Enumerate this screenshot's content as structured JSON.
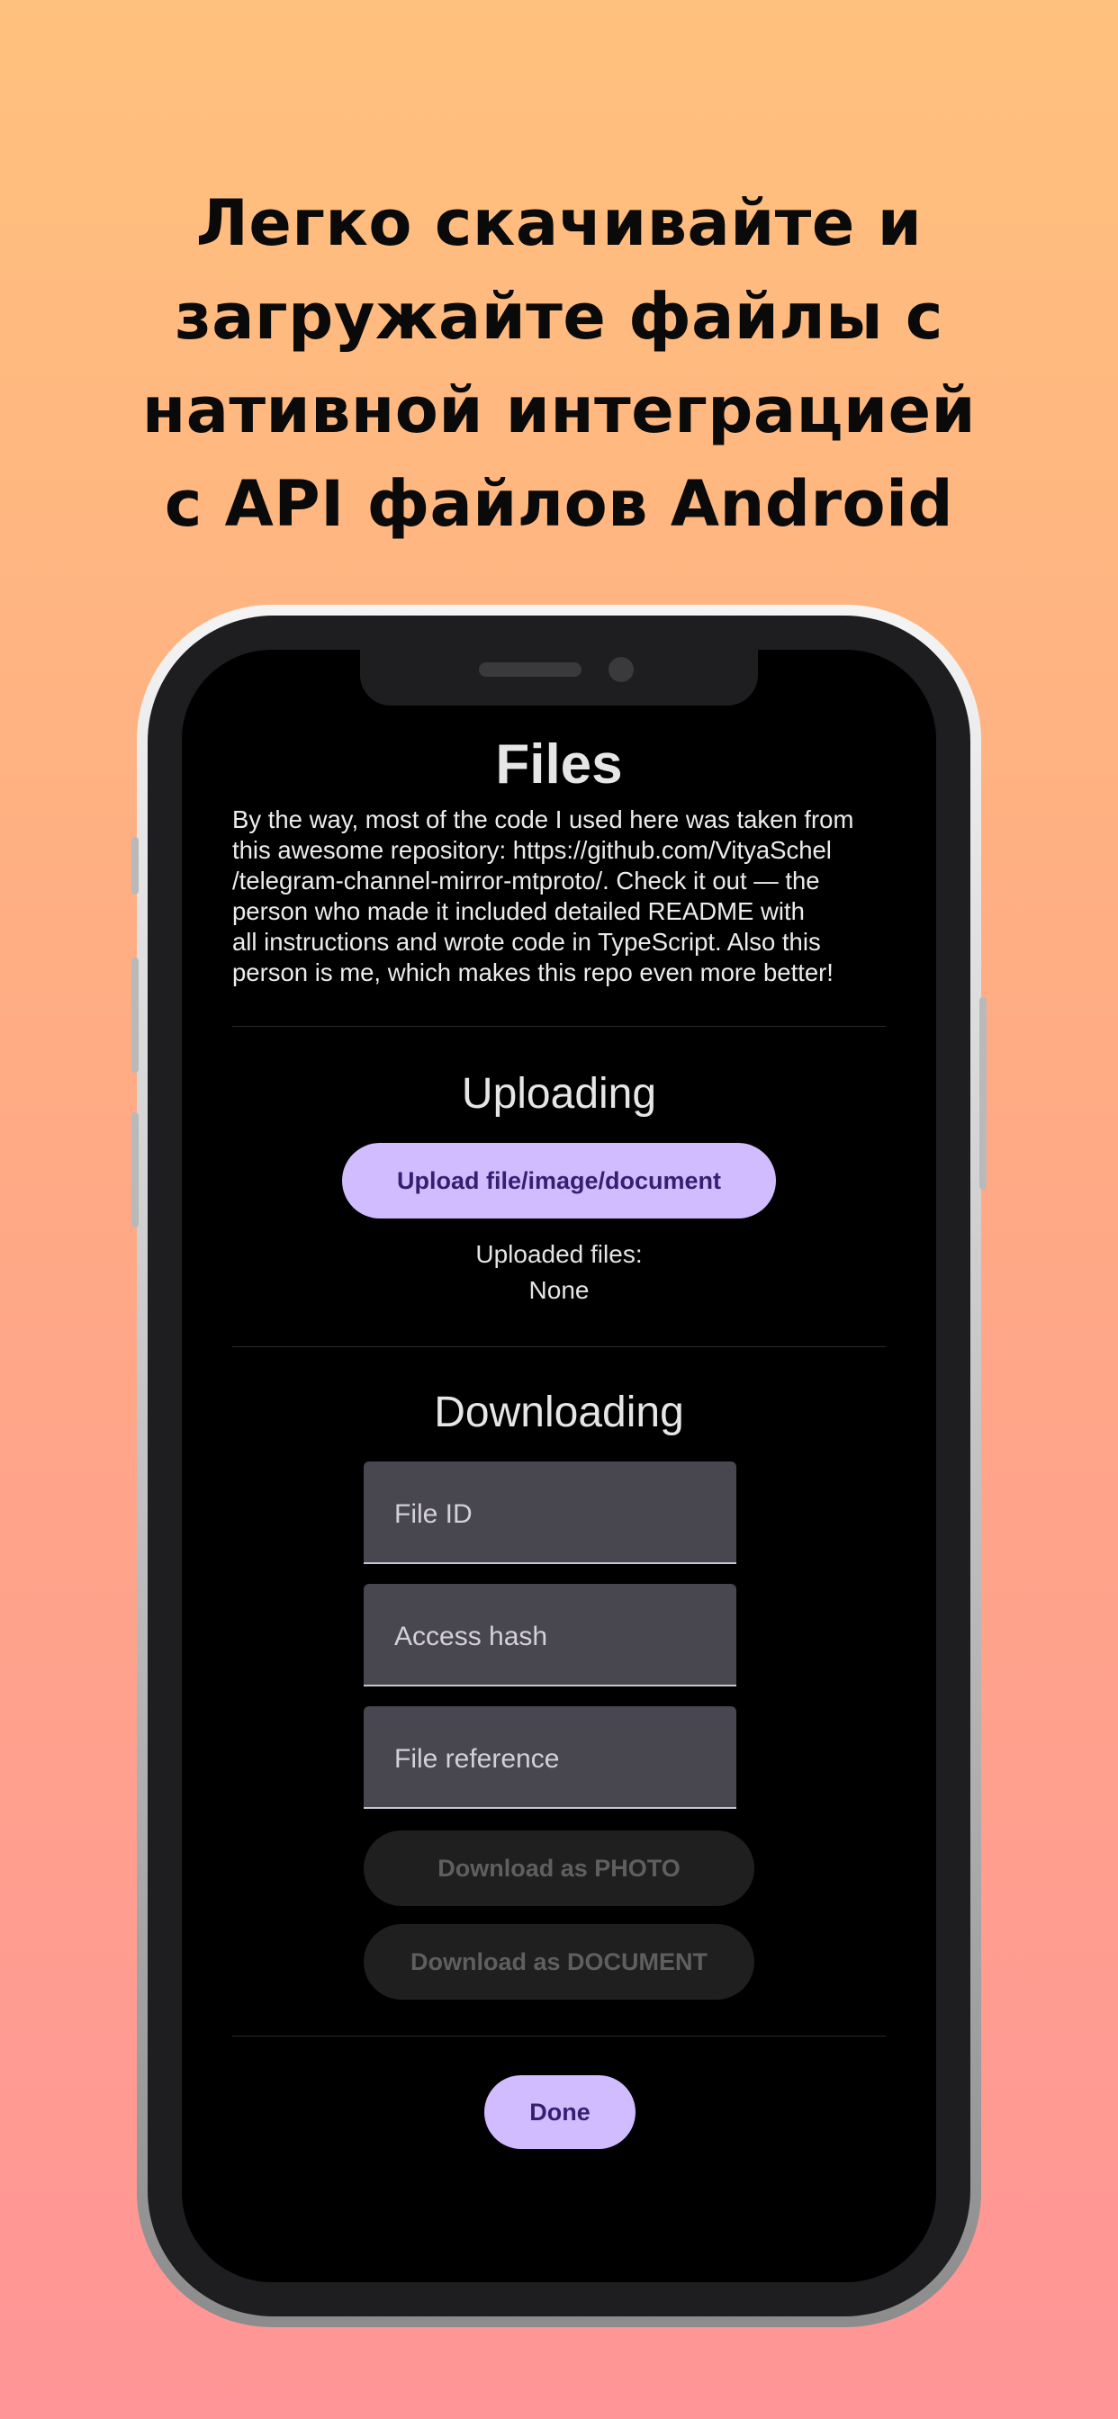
{
  "headline": {
    "lines": [
      "Легко скачивайте и",
      "загружайте файлы с",
      "нативной интеграцией",
      "с API файлов Android"
    ]
  },
  "screen": {
    "title": "Files",
    "description": "By the way, most of the code I used here was taken from\nthis awesome repository: https://github.com/VityaSchel\n/telegram-channel-mirror-mtproto/. Check it out — the\nperson who made it included detailed README with\nall instructions and wrote code in TypeScript. Also this\nperson is me, which makes this repo even more better!",
    "uploading": {
      "title": "Uploading",
      "button_label": "Upload file/image/document",
      "uploaded_label": "Uploaded files:",
      "uploaded_value": "None"
    },
    "downloading": {
      "title": "Downloading",
      "fields": [
        {
          "label": "File ID"
        },
        {
          "label": "Access hash"
        },
        {
          "label": "File reference"
        }
      ],
      "download_photo_label": "Download as PHOTO",
      "download_document_label": "Download as DOCUMENT"
    },
    "done_label": "Done"
  },
  "colors": {
    "accent": "#d0bcff",
    "accent_text": "#381e72",
    "field_bg": "#48464f",
    "background_top": "#ffc17d",
    "background_bottom": "#ff9597"
  }
}
